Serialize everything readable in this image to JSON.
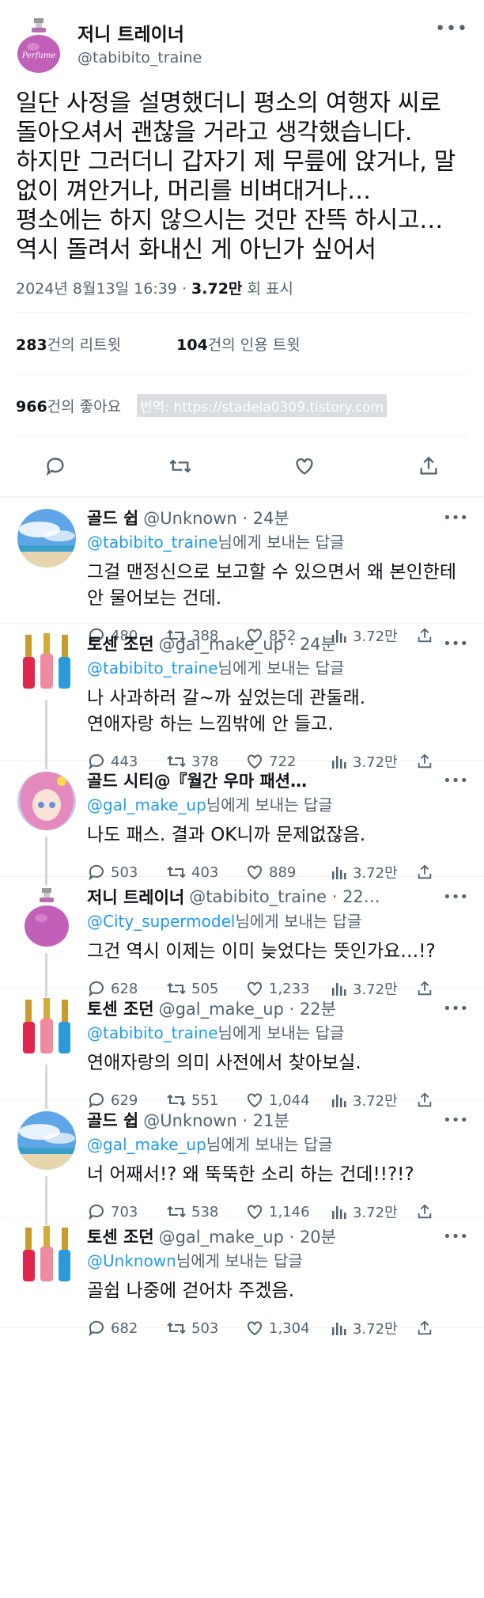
{
  "main_tweet": {
    "name": "저니 트레이너",
    "handle": "@tabibito_traine",
    "avatar_icon": "perfume-bottle-avatar-icon",
    "avatar_label": "Perfume",
    "text": "일단 사정을 설명했더니 평소의 여행자 씨로 돌아오셔서 괜찮을 거라고 생각했습니다.\n하지만 그러더니 갑자기 제 무릎에 앉거나, 말없이 껴안거나, 머리를 비벼대거나…\n평소에는 하지 않으시는 것만 잔뜩 하시고…\n역시 돌려서 화내신 게 아닌가 싶어서",
    "timestamp": "2024년 8월13일 16:39",
    "views_count": "3.72만",
    "views_label": "회 표시",
    "retweets_count": "283",
    "retweets_label": "건의 리트윗",
    "quotes_count": "104",
    "quotes_label": "건의 인용 트윗",
    "likes_count": "966",
    "likes_label": "건의 좋아요",
    "watermark": "번역: https://stadela0309.tistory.com"
  },
  "reply_to_suffix": "님에게 보내는 답글",
  "replies": [
    {
      "name": "골드 쉽",
      "handle": "@Unknown · 24분",
      "avatar": "sky-beach",
      "mention": "@tabibito_traine",
      "text": "그걸 맨정신으로 보고할 수 있으면서 왜 본인한테 안 물어보는 건데.",
      "replies": "480",
      "retweets": "388",
      "likes": "852",
      "views": "3.72만"
    },
    {
      "name": "토센 조던",
      "handle": "@gal_make_up · 24분",
      "avatar": "nail-polish",
      "mention": "@tabibito_traine",
      "text": "나 사과하러 갈~까 싶었는데 관둘래.\n연애자랑 하는 느낌밖에 안 들고.",
      "replies": "443",
      "retweets": "378",
      "likes": "722",
      "views": "3.72만"
    },
    {
      "name": "골드 시티@『월간 우마 패션…",
      "handle": "",
      "avatar": "anime-girl",
      "mention": "@gal_make_up",
      "text": "나도 패스. 결과 OK니까 문제없잖음.",
      "replies": "503",
      "retweets": "403",
      "likes": "889",
      "views": "3.72만"
    },
    {
      "name": "저니 트레이너",
      "handle": "@tabibito_traine · 22…",
      "avatar": "perfume",
      "mention": "@City_supermodel",
      "text": "그건 역시 이제는 이미 늦었다는 뜻인가요…!?",
      "replies": "628",
      "retweets": "505",
      "likes": "1,233",
      "views": "3.72만"
    },
    {
      "name": "토센 조던",
      "handle": "@gal_make_up · 22분",
      "avatar": "nail-polish",
      "mention": "@tabibito_traine",
      "text": "연애자랑의 의미 사전에서 찾아보실.",
      "replies": "629",
      "retweets": "551",
      "likes": "1,044",
      "views": "3.72만"
    },
    {
      "name": "골드 쉽",
      "handle": "@Unknown · 21분",
      "avatar": "sky-beach",
      "mention": "@gal_make_up",
      "text": "너 어째서!? 왜 뚝뚝한 소리 하는 건데!!?!?",
      "replies": "703",
      "retweets": "538",
      "likes": "1,146",
      "views": "3.72만"
    },
    {
      "name": "토센 조던",
      "handle": "@gal_make_up · 20분",
      "avatar": "nail-polish",
      "mention": "@Unknown",
      "text": "골쉽 나중에 걷어차 주겠음.",
      "replies": "682",
      "retweets": "503",
      "likes": "1,304",
      "views": "3.72만"
    }
  ]
}
